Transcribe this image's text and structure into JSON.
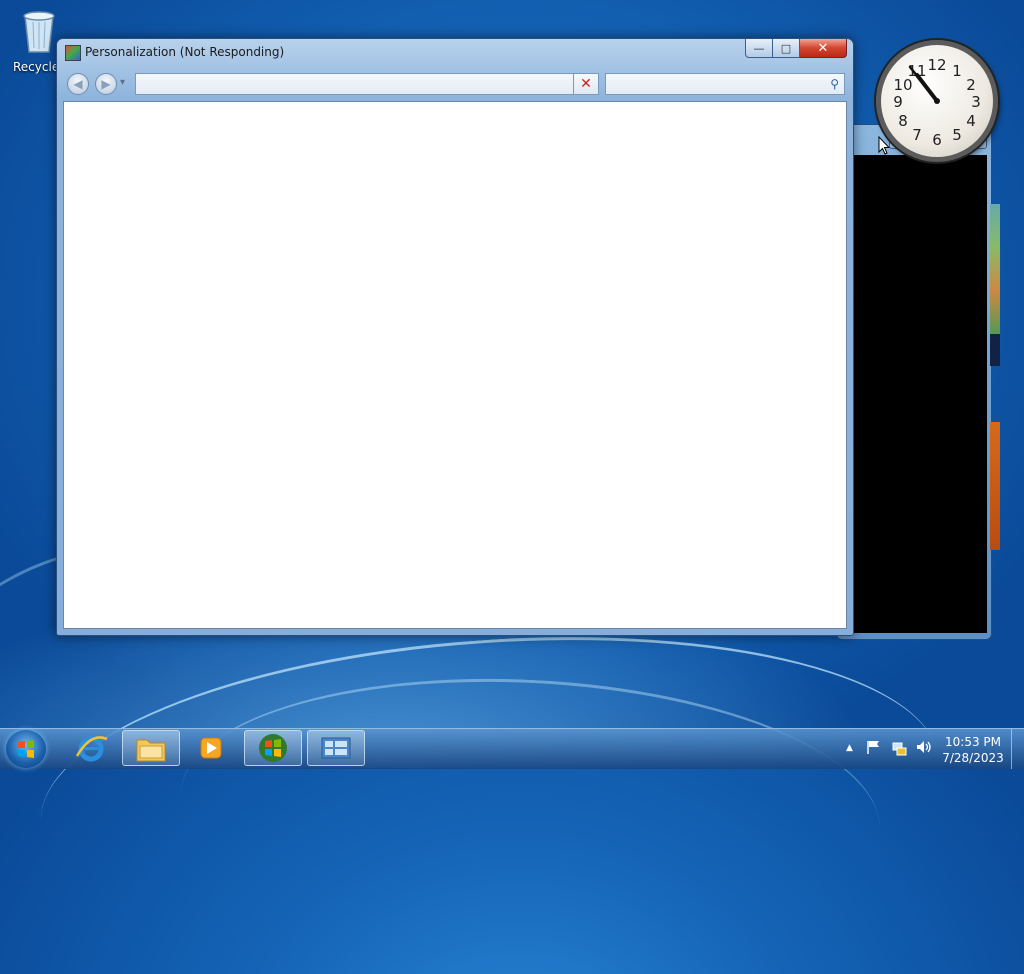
{
  "desktop": {
    "recycle_bin_label": "Recycle Bin"
  },
  "clock_gadget": {
    "numbers": [
      "12",
      "1",
      "2",
      "3",
      "4",
      "5",
      "6",
      "7",
      "8",
      "9",
      "10",
      "11"
    ]
  },
  "background_window": {
    "min_glyph": "—",
    "max_glyph": "□",
    "close_glyph": "✕"
  },
  "window": {
    "title": "Personalization (Not Responding)",
    "min_glyph": "—",
    "max_glyph": "□",
    "close_glyph": "✕",
    "back_glyph": "◀",
    "forward_glyph": "▶",
    "history_glyph": "▾",
    "address_value": "",
    "address_drop_glyph": "▼",
    "address_clear_glyph": "✕",
    "search_value": "",
    "search_glyph": "⚲"
  },
  "taskbar": {
    "items": [
      {
        "name": "internet-explorer",
        "icon": "ie-icon",
        "open": false
      },
      {
        "name": "windows-explorer",
        "icon": "folder-icon",
        "open": true
      },
      {
        "name": "media-player",
        "icon": "media-player-icon",
        "open": false
      },
      {
        "name": "windows",
        "icon": "windows-logo-icon",
        "open": true
      },
      {
        "name": "control-panel",
        "icon": "control-panel-icon",
        "open": true
      }
    ],
    "tray": {
      "show_hidden_glyph": "▲",
      "time": "10:53 PM",
      "date": "7/28/2023"
    }
  },
  "colors": {
    "desktop_blue": "#1565b8",
    "close_red": "#d2452e",
    "window_frame": "#8eb4dc"
  }
}
